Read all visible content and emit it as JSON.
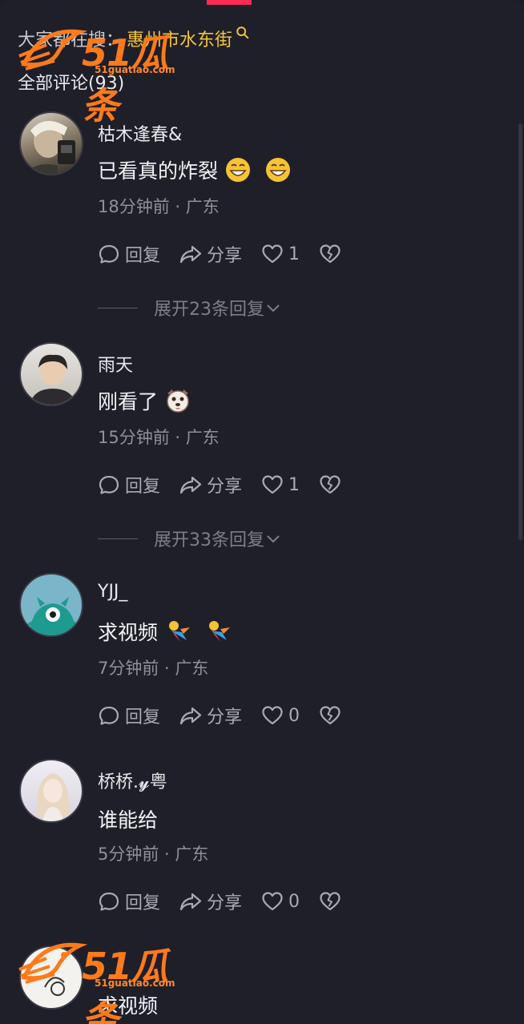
{
  "header": {
    "search_prefix": "大家都在搜：",
    "search_keyword": "惠州市水东街",
    "comments_count_label": "全部评论(93)"
  },
  "watermark": {
    "brand": "51瓜条",
    "domain": "51guatiao.com"
  },
  "comments": [
    {
      "username": "枯木逢春&",
      "text": "已看真的炸裂",
      "emojis": [
        "grin-emoji",
        "grin-emoji"
      ],
      "meta": "18分钟前 · 广东",
      "reply_label": "回复",
      "share_label": "分享",
      "likes": "1",
      "expand_label": "展开23条回复"
    },
    {
      "username": "雨天",
      "text": "刚看了",
      "emojis": [
        "dog-emoji"
      ],
      "meta": "15分钟前 · 广东",
      "reply_label": "回复",
      "share_label": "分享",
      "likes": "1",
      "expand_label": "展开33条回复"
    },
    {
      "username": "YJJ_",
      "text": "求视频",
      "emojis": [
        "flying-emoji",
        "flying-emoji"
      ],
      "meta": "7分钟前 · 广东",
      "reply_label": "回复",
      "share_label": "分享",
      "likes": "0"
    },
    {
      "username": "桥桥.𝔂粤",
      "text": "谁能给",
      "emojis": [],
      "meta": "5分钟前 · 广东",
      "reply_label": "回复",
      "share_label": "分享",
      "likes": "0"
    },
    {
      "username": "",
      "text": "求视频",
      "emojis": []
    }
  ],
  "colors": {
    "background": "#1e1f29",
    "accent": "#fe2c55",
    "keyword": "#f5c431",
    "watermark": "#ff7a1a"
  }
}
